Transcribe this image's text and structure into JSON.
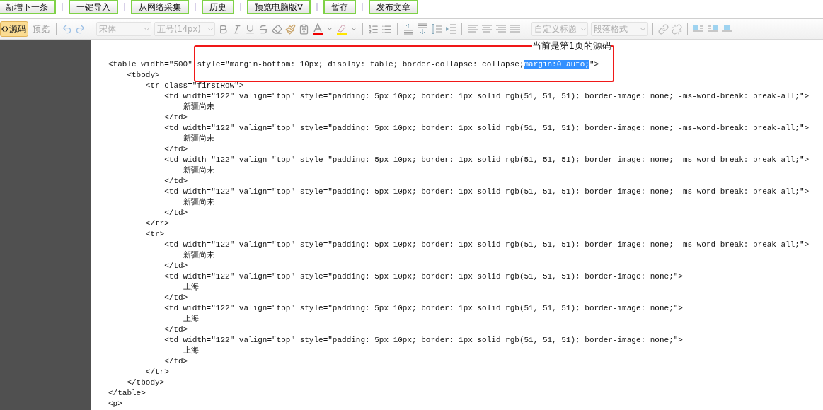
{
  "actions": [
    {
      "label": "新增下一条"
    },
    {
      "label": "一键导入"
    },
    {
      "label": "从网络采集"
    },
    {
      "label": "历史"
    },
    {
      "label": "预览电脑版∇"
    },
    {
      "label": "暂存"
    },
    {
      "label": "发布文章"
    }
  ],
  "toolbar": {
    "source_button": {
      "label": "源码",
      "selected": true
    },
    "preview_button": {
      "label": "预览",
      "disabled": true
    },
    "font_select": {
      "value": "宋体",
      "disabled": true
    },
    "size_select": {
      "value": "五号(14px)",
      "disabled": true
    },
    "heading_select": {
      "value": "自定义标题",
      "disabled": true
    },
    "paragraph_select": {
      "value": "段落格式",
      "disabled": true
    }
  },
  "annotation": {
    "label": "当前是第1页的源码"
  },
  "code_lines": [
    {
      "segments": [
        {
          "text": "<table width=\"500\" style=\"margin-bottom: 10px; display: table; border-collapse: collapse;",
          "selected": false
        },
        {
          "text": "margin:0 auto;",
          "selected": true
        },
        {
          "text": "\">",
          "selected": false
        }
      ]
    },
    {
      "segments": [
        {
          "text": "    <tbody>",
          "selected": false
        }
      ]
    },
    {
      "segments": [
        {
          "text": "        <tr class=\"firstRow\">",
          "selected": false
        }
      ]
    },
    {
      "segments": [
        {
          "text": "            <td width=\"122\" valign=\"top\" style=\"padding: 5px 10px; border: 1px solid rgb(51, 51, 51); border-image: none; -ms-word-break: break-all;\">",
          "selected": false
        }
      ]
    },
    {
      "segments": [
        {
          "text": "                新疆尚未",
          "selected": false
        }
      ]
    },
    {
      "segments": [
        {
          "text": "            </td>",
          "selected": false
        }
      ]
    },
    {
      "segments": [
        {
          "text": "            <td width=\"122\" valign=\"top\" style=\"padding: 5px 10px; border: 1px solid rgb(51, 51, 51); border-image: none; -ms-word-break: break-all;\">",
          "selected": false
        }
      ]
    },
    {
      "segments": [
        {
          "text": "                新疆尚未",
          "selected": false
        }
      ]
    },
    {
      "segments": [
        {
          "text": "            </td>",
          "selected": false
        }
      ]
    },
    {
      "segments": [
        {
          "text": "            <td width=\"122\" valign=\"top\" style=\"padding: 5px 10px; border: 1px solid rgb(51, 51, 51); border-image: none; -ms-word-break: break-all;\">",
          "selected": false
        }
      ]
    },
    {
      "segments": [
        {
          "text": "                新疆尚未",
          "selected": false
        }
      ]
    },
    {
      "segments": [
        {
          "text": "            </td>",
          "selected": false
        }
      ]
    },
    {
      "segments": [
        {
          "text": "            <td width=\"122\" valign=\"top\" style=\"padding: 5px 10px; border: 1px solid rgb(51, 51, 51); border-image: none; -ms-word-break: break-all;\">",
          "selected": false
        }
      ]
    },
    {
      "segments": [
        {
          "text": "                新疆尚未",
          "selected": false
        }
      ]
    },
    {
      "segments": [
        {
          "text": "            </td>",
          "selected": false
        }
      ]
    },
    {
      "segments": [
        {
          "text": "        </tr>",
          "selected": false
        }
      ]
    },
    {
      "segments": [
        {
          "text": "        <tr>",
          "selected": false
        }
      ]
    },
    {
      "segments": [
        {
          "text": "            <td width=\"122\" valign=\"top\" style=\"padding: 5px 10px; border: 1px solid rgb(51, 51, 51); border-image: none; -ms-word-break: break-all;\">",
          "selected": false
        }
      ]
    },
    {
      "segments": [
        {
          "text": "                新疆尚未",
          "selected": false
        }
      ]
    },
    {
      "segments": [
        {
          "text": "            </td>",
          "selected": false
        }
      ]
    },
    {
      "segments": [
        {
          "text": "            <td width=\"122\" valign=\"top\" style=\"padding: 5px 10px; border: 1px solid rgb(51, 51, 51); border-image: none;\">",
          "selected": false
        }
      ]
    },
    {
      "segments": [
        {
          "text": "                上海",
          "selected": false
        }
      ]
    },
    {
      "segments": [
        {
          "text": "            </td>",
          "selected": false
        }
      ]
    },
    {
      "segments": [
        {
          "text": "            <td width=\"122\" valign=\"top\" style=\"padding: 5px 10px; border: 1px solid rgb(51, 51, 51); border-image: none;\">",
          "selected": false
        }
      ]
    },
    {
      "segments": [
        {
          "text": "                上海",
          "selected": false
        }
      ]
    },
    {
      "segments": [
        {
          "text": "            </td>",
          "selected": false
        }
      ]
    },
    {
      "segments": [
        {
          "text": "            <td width=\"122\" valign=\"top\" style=\"padding: 5px 10px; border: 1px solid rgb(51, 51, 51); border-image: none;\">",
          "selected": false
        }
      ]
    },
    {
      "segments": [
        {
          "text": "                上海",
          "selected": false
        }
      ]
    },
    {
      "segments": [
        {
          "text": "            </td>",
          "selected": false
        }
      ]
    },
    {
      "segments": [
        {
          "text": "        </tr>",
          "selected": false
        }
      ]
    },
    {
      "segments": [
        {
          "text": "    </tbody>",
          "selected": false
        }
      ]
    },
    {
      "segments": [
        {
          "text": "</table>",
          "selected": false
        }
      ]
    },
    {
      "segments": [
        {
          "text": "<p>",
          "selected": false
        }
      ]
    }
  ]
}
